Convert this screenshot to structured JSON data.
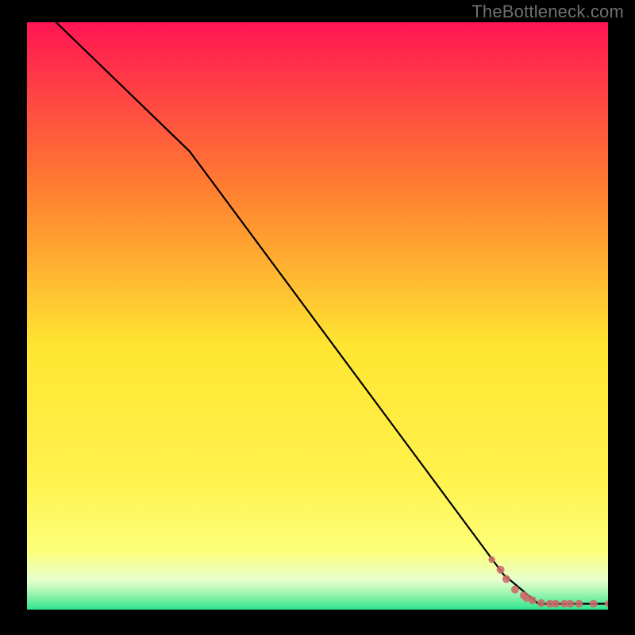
{
  "watermark": "TheBottleneck.com",
  "colors": {
    "frame": "#000000",
    "watermark": "#6f6f6f",
    "line": "#000000",
    "marker": "#cb6a68",
    "gradient_top": "#ff1553",
    "gradient_mid_upper": "#ff8a2f",
    "gradient_mid": "#ffe531",
    "gradient_mid_lower": "#fdff7a",
    "gradient_pale": "#fbffd1",
    "gradient_bottom": "#2fe690"
  },
  "chart_data": {
    "type": "line",
    "title": "",
    "xlabel": "",
    "ylabel": "",
    "xlim": [
      0,
      100
    ],
    "ylim": [
      0,
      100
    ],
    "series": [
      {
        "name": "curve",
        "x": [
          5,
          28,
          82,
          88,
          100
        ],
        "y": [
          100,
          78,
          6,
          1,
          1
        ]
      }
    ],
    "markers": {
      "name": "points",
      "x": [
        80,
        81.5,
        82.5,
        84,
        85.5,
        86,
        87,
        88.5,
        90,
        91,
        92.5,
        93.5,
        95,
        97.5,
        100
      ],
      "y": [
        8.5,
        6.8,
        5.2,
        3.4,
        2.4,
        2.0,
        1.6,
        1.1,
        1.0,
        1.0,
        1.0,
        1.0,
        1.0,
        1.0,
        1.0
      ]
    }
  }
}
